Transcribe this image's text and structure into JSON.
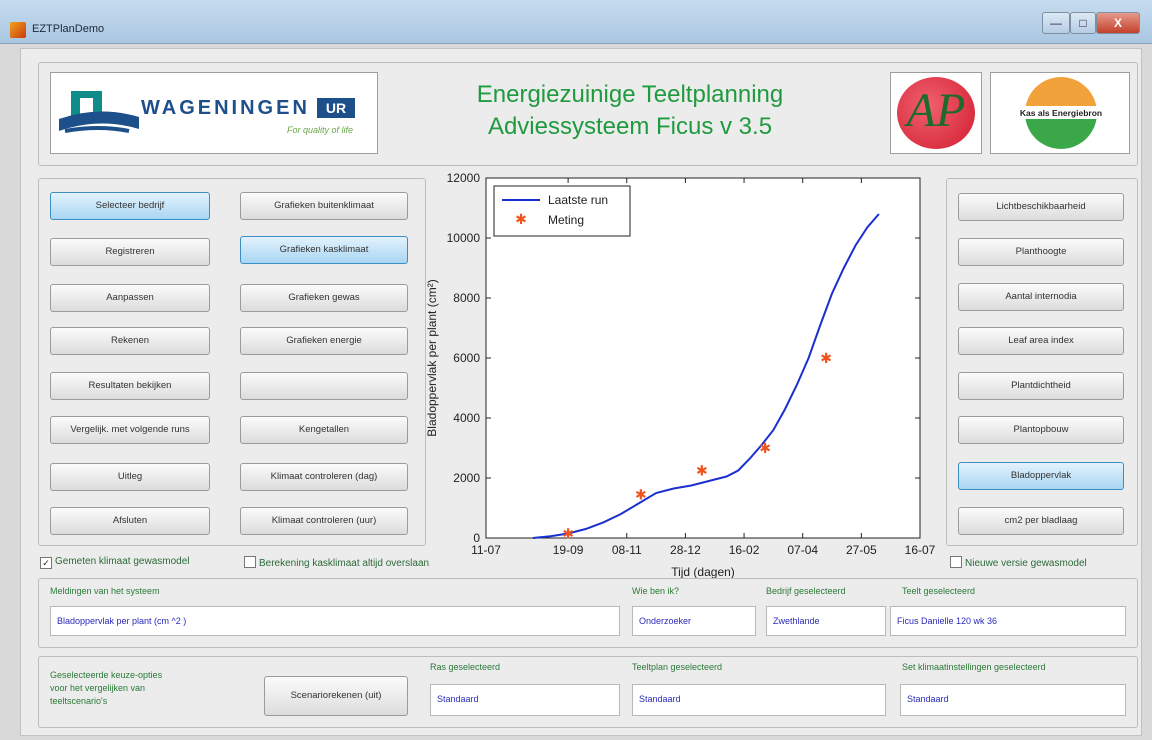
{
  "window": {
    "title": "EZTPlanDemo",
    "minimize": "—",
    "maximize": "□",
    "close": "X"
  },
  "header": {
    "logo_wageningen": "WAGENINGEN",
    "logo_wageningen_ur": "UR",
    "logo_wageningen_tagline": "For quality of life",
    "title_line1": "Energiezuinige Teeltplanning",
    "title_line2": "Adviessysteem Ficus v 3.5",
    "logo_ap": "AP",
    "logo_kas": "Kas als Energiebron"
  },
  "left_buttons": [
    {
      "label": "Selecteer bedrijf",
      "highlighted": true
    },
    {
      "label": "Registreren"
    },
    {
      "label": "Aanpassen"
    },
    {
      "label": "Rekenen"
    },
    {
      "label": "Resultaten bekijken"
    },
    {
      "label": "Vergelijk. met volgende runs"
    },
    {
      "label": "Uitleg"
    },
    {
      "label": "Afsluten"
    }
  ],
  "mid_buttons": [
    {
      "label": "Grafieken buitenklimaat"
    },
    {
      "label": "Grafieken kasklimaat",
      "highlighted": true
    },
    {
      "label": "Grafieken gewas"
    },
    {
      "label": "Grafieken energie"
    },
    {
      "label": ""
    },
    {
      "label": "Kengetallen"
    },
    {
      "label": "Klimaat controleren (dag)"
    },
    {
      "label": "Klimaat controleren (uur)"
    }
  ],
  "right_buttons": [
    {
      "label": "Lichtbeschikbaarheid"
    },
    {
      "label": "Planthoogte"
    },
    {
      "label": "Aantal internodia"
    },
    {
      "label": "Leaf area index"
    },
    {
      "label": "Plantdichtheid"
    },
    {
      "label": "Plantopbouw"
    },
    {
      "label": "Bladoppervlak",
      "highlighted": true
    },
    {
      "label": "cm2 per bladlaag"
    }
  ],
  "checkboxes": {
    "gemeten": {
      "label": "Gemeten klimaat gewasmodel",
      "checked": true
    },
    "berekening": {
      "label": "Berekening kasklimaat altijd overslaan",
      "checked": false
    },
    "nieuwe": {
      "label": "Nieuwe versie gewasmodel",
      "checked": false
    }
  },
  "status": {
    "meldingen_label": "Meldingen van het systeem",
    "meldingen_value": "Bladoppervlak per plant (cm ^2 )",
    "wie_label": "Wie ben ik?",
    "wie_value": "Onderzoeker",
    "bedrijf_label": "Bedrijf geselecteerd",
    "bedrijf_value": "Zwethlande",
    "teelt_label": "Teelt geselecteerd",
    "teelt_value": "Ficus Danielle 120 wk 36"
  },
  "bottom": {
    "keuze_label_1": "Geselecteerde keuze-opties",
    "keuze_label_2": "voor het vergelijken van",
    "keuze_label_3": "teeltscenario's",
    "scenario_button": "Scenariorekenen (uit)",
    "ras_label": "Ras geselecteerd",
    "ras_value": "Standaard",
    "teeltplan_label": "Teeltplan geselecteerd",
    "teeltplan_value": "Standaard",
    "klimaat_label": "Set klimaatinstellingen geselecteerd",
    "klimaat_value": "Standaard"
  },
  "colors": {
    "accent_green": "#1f9a3e",
    "highlight_blue": "#a9d6f3",
    "line_blue": "#1a2fd0",
    "marker_red": "#f0541e"
  },
  "chart_data": {
    "type": "line",
    "xlabel": "Tijd (dagen)",
    "ylabel": "Bladoppervlak per plant (cm²)",
    "x_tick_labels": [
      "11-07",
      "19-09",
      "08-11",
      "28-12",
      "16-02",
      "07-04",
      "27-05",
      "16-07"
    ],
    "x_ticks_day": [
      0,
      70,
      120,
      170,
      220,
      270,
      320,
      370
    ],
    "ylim": [
      0,
      12000
    ],
    "y_ticks": [
      0,
      2000,
      4000,
      6000,
      8000,
      10000,
      12000
    ],
    "legend_position": "top-left",
    "series": [
      {
        "name": "Laatste run",
        "kind": "line",
        "x": [
          40,
          55,
          70,
          85,
          100,
          115,
          130,
          145,
          160,
          175,
          185,
          195,
          205,
          215,
          225,
          235,
          245,
          255,
          265,
          275,
          285,
          295,
          305,
          315,
          325,
          335
        ],
        "y": [
          0,
          60,
          150,
          300,
          520,
          800,
          1150,
          1500,
          1650,
          1750,
          1850,
          1950,
          2050,
          2250,
          2650,
          3100,
          3600,
          4300,
          5100,
          6000,
          7100,
          8150,
          9000,
          9750,
          10350,
          10800
        ]
      },
      {
        "name": "Meting",
        "kind": "scatter",
        "x": [
          70,
          132,
          184,
          238,
          290
        ],
        "y": [
          150,
          1450,
          2250,
          3000,
          6000
        ]
      }
    ]
  }
}
